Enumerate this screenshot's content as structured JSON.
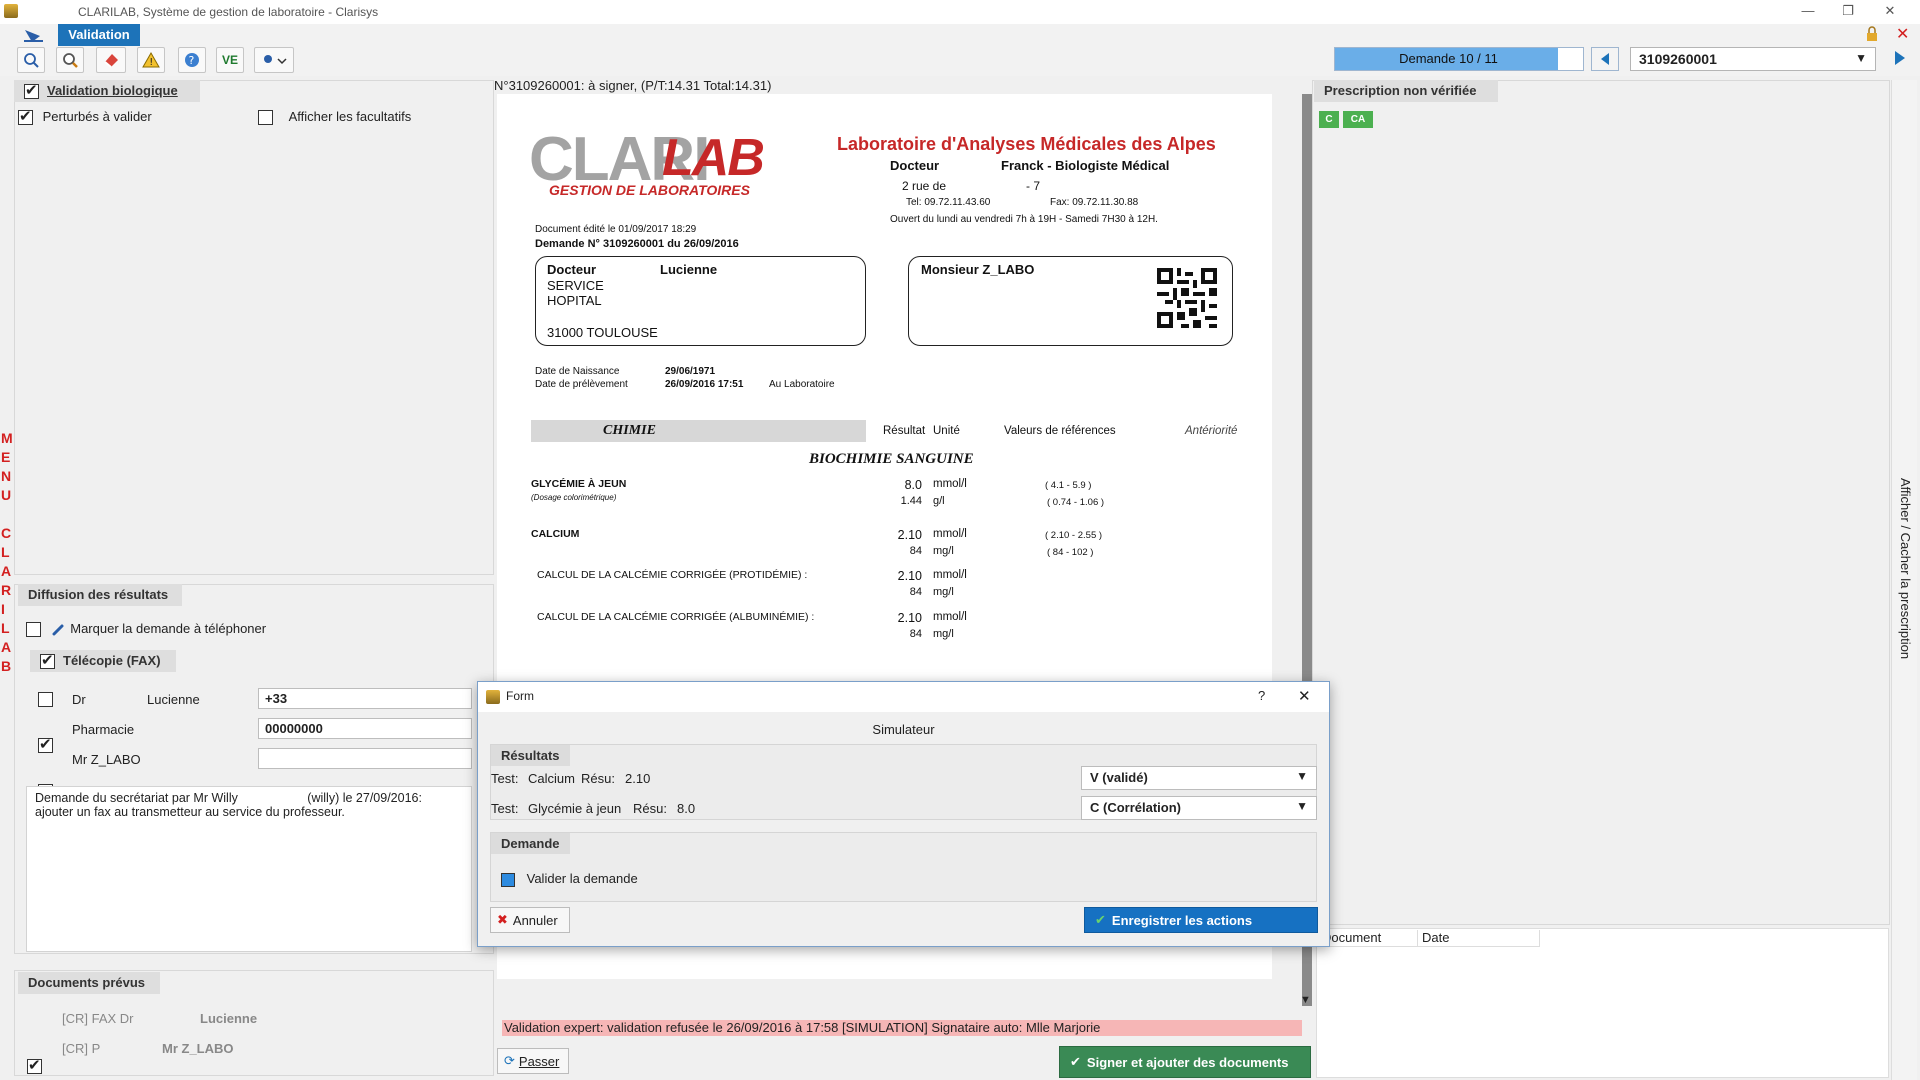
{
  "window": {
    "title": "CLARILAB, Système de gestion de laboratoire - Clarisys",
    "minimize": "—",
    "restore": "❐",
    "close": "✕"
  },
  "toolbar": {
    "active_tab": "Validation",
    "ve_label": "VE",
    "demand_counter": "Demande 10 / 11",
    "demand_progress": 0.9,
    "demand_id": "3109260001"
  },
  "side_menu": {
    "letters": [
      "M",
      "E",
      "N",
      "U",
      "",
      "C",
      "L",
      "A",
      "R",
      "I",
      "L",
      "A",
      "B"
    ]
  },
  "left": {
    "validation_header": "Validation biologique",
    "perturbed_label": "Perturbés à valider",
    "optional_label": "Afficher les facultatifs",
    "diffusion_header": "Diffusion des résultats",
    "phone_label": "Marquer la demande à téléphoner",
    "fax_header": "Télécopie (FAX)",
    "fax_rows": [
      {
        "name": "Dr",
        "name2": "Lucienne",
        "value": "+33",
        "checked": false
      },
      {
        "name": "Pharmacie",
        "name2": "",
        "value": "00000000",
        "checked": true
      },
      {
        "name": "Mr Z_LABO",
        "name2": "",
        "value": "",
        "checked": false
      }
    ],
    "comment_line1": "Demande du secrétariat par Mr Willy                    (willy) le 27/09/2016:",
    "comment_line2": "ajouter un fax au transmetteur au service du professeur.",
    "docs_header": "Documents prévus",
    "docs": [
      {
        "prefix": "[CR] FAX Dr",
        "name": "Lucienne"
      },
      {
        "prefix": "[CR] P",
        "name": "Mr Z_LABO"
      }
    ]
  },
  "center": {
    "status_line": "N°3109260001: à signer,  (P/T:14.31 Total:14.31)",
    "report": {
      "logo_main": "CLARI",
      "logo_accent": "LAB",
      "logo_sub": "GESTION DE LABORATOIRES",
      "lab_name": "Laboratoire d'Analyses Médicales des Alpes",
      "doctor_label": "Docteur",
      "doctor_name": "Franck - Biologiste Médical",
      "address": "2 rue de                        - 7",
      "tel": "Tel:   09.72.11.43.60",
      "fax": "Fax:  09.72.11.30.88",
      "hours": "Ouvert du lundi au vendredi 7h à 19H - Samedi 7H30 à 12H.",
      "edited": "Document édité le   01/09/2017 18:29",
      "demand_no": "Demande N° 3109260001 du 26/09/2016",
      "doctor_box": {
        "line1a": "Docteur",
        "line1b": "Lucienne",
        "line2": "SERVICE",
        "line3": "HOPITAL",
        "line4": "31000  TOULOUSE"
      },
      "patient": "Monsieur Z_LABO",
      "birth_label": "Date de Naissance",
      "birth_value": "29/06/1971",
      "sample_label": "Date de prélèvement",
      "sample_value": "26/09/2016 17:51",
      "sample_place": "Au Laboratoire",
      "section": "CHIMIE",
      "col_result": "Résultat",
      "col_unit": "Unité",
      "col_ref": "Valeurs de références",
      "col_prev": "Antériorité",
      "subsection": "BIOCHIMIE SANGUINE",
      "tests": [
        {
          "name": "GLYCÉMIE À JEUN",
          "method": "(Dosage colorimétrique)",
          "v1": "8.0",
          "u1": "mmol/l",
          "r1": "( 4.1 - 5.9 )",
          "v2": "1.44",
          "u2": "g/l",
          "r2": "( 0.74 - 1.06 )"
        },
        {
          "name": "CALCIUM",
          "method": "",
          "v1": "2.10",
          "u1": "mmol/l",
          "r1": "( 2.10 - 2.55 )",
          "v2": "84",
          "u2": "mg/l",
          "r2": "( 84 - 102 )"
        },
        {
          "name": "CALCUL DE LA CALCÉMIE CORRIGÉE (PROTIDÉMIE) :",
          "method": "",
          "v1": "2.10",
          "u1": "mmol/l",
          "r1": "",
          "v2": "84",
          "u2": "mg/l",
          "r2": ""
        },
        {
          "name": "CALCUL DE LA CALCÉMIE CORRIGÉE (ALBUMINÉMIE) :",
          "method": "",
          "v1": "2.10",
          "u1": "mmol/l",
          "r1": "",
          "v2": "84",
          "u2": "mg/l",
          "r2": ""
        }
      ]
    },
    "expert_banner": "Validation expert: validation refusée le 26/09/2016 à 17:58  [SIMULATION]  Signataire auto: Mlle Marjorie",
    "pass_button": "Passer",
    "sign_button": "Signer et ajouter des documents"
  },
  "right": {
    "header": "Prescription non vérifiée",
    "badge1": "C",
    "badge2": "CA",
    "vertical_label": "Afficher / Cacher la prescription",
    "col_doc": "Document",
    "col_date": "Date"
  },
  "dialog": {
    "title": "Form",
    "help": "?",
    "close": "✕",
    "heading": "Simulateur",
    "results_header": "Résultats",
    "rows": [
      {
        "test_label": "Test:",
        "test": "Calcium",
        "res_label": "Résu:",
        "res": "2.10",
        "choice": "V (validé)"
      },
      {
        "test_label": "Test:",
        "test": "Glycémie à jeun",
        "res_label": "Résu:",
        "res": "8.0",
        "choice": "C (Corrélation)"
      }
    ],
    "demand_header": "Demande",
    "validate_label": "Valider la demande",
    "cancel": "Annuler",
    "save": "Enregistrer les actions"
  },
  "colors": {
    "accent": "#1d73b9",
    "logo_red": "#c62828",
    "banner": "#f6b6b6",
    "sign_green": "#3a8a55"
  }
}
